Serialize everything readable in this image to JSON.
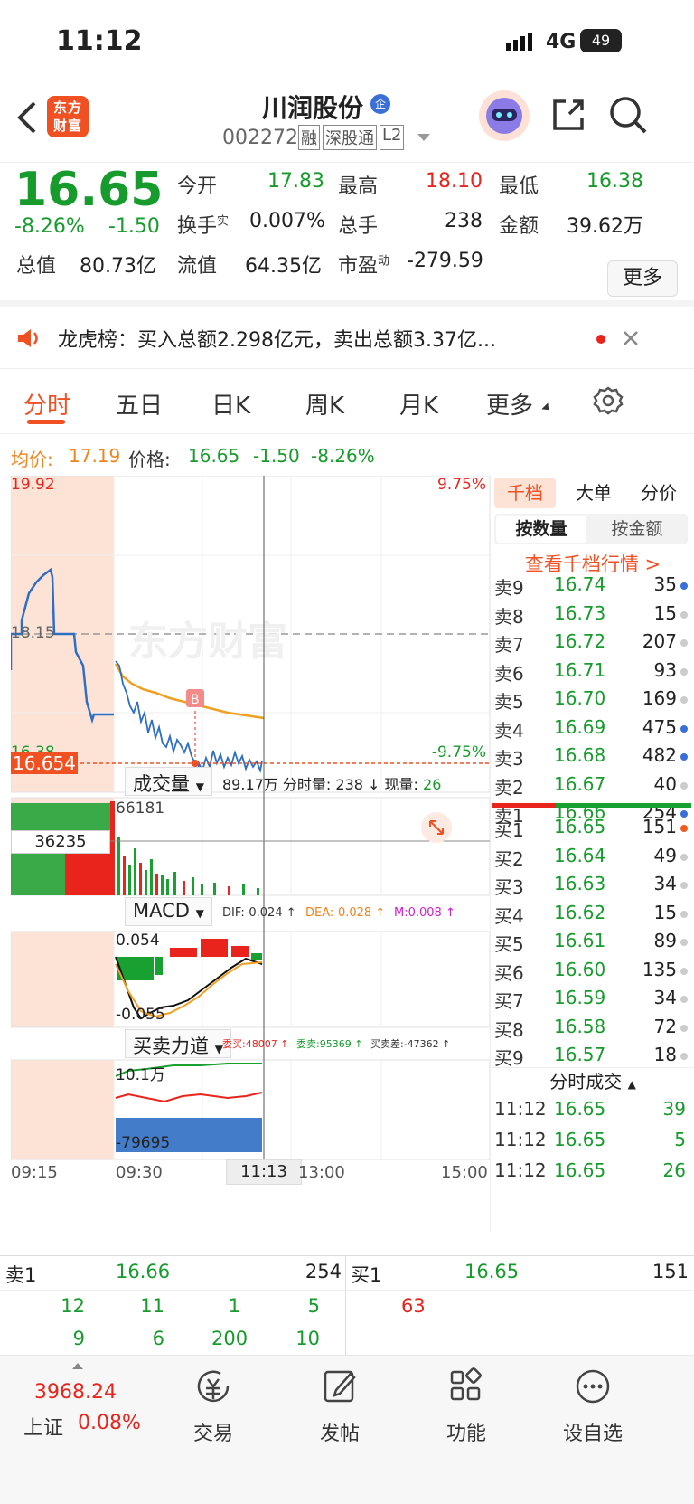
{
  "status_bar": {
    "time": "11:12",
    "network": "4G",
    "battery": "49"
  },
  "nav": {
    "app_logo": "东方财富",
    "stock_name": "川润股份",
    "name_badge": "企",
    "code": "002272",
    "tags": [
      "融",
      "深股通",
      "L2"
    ]
  },
  "quote": {
    "price": "16.65",
    "change_pct": "-8.26%",
    "change": "-1.50",
    "fields": [
      {
        "label": "今开",
        "value": "17.83"
      },
      {
        "label": "最高",
        "value": "18.10"
      },
      {
        "label": "最低",
        "value": "16.38"
      },
      {
        "label": "换手",
        "sup": "实",
        "value": "0.007%"
      },
      {
        "label": "总手",
        "value": "238"
      },
      {
        "label": "金额",
        "value": "39.62万"
      },
      {
        "label": "总值",
        "value": "80.73亿"
      },
      {
        "label": "流值",
        "value": "64.35亿"
      },
      {
        "label": "市盈",
        "sup": "动",
        "value": "-279.59"
      }
    ],
    "more_button": "更多"
  },
  "news": {
    "text": "龙虎榜：买入总额2.298亿元，卖出总额3.37亿..."
  },
  "tabs": [
    "分时",
    "五日",
    "日K",
    "周K",
    "月K",
    "更多"
  ],
  "legend": {
    "avg_label": "均价:",
    "avg_value": "17.19",
    "price_label": "价格:",
    "price_value": "16.65",
    "change": "-1.50",
    "change_pct": "-8.26%"
  },
  "chart": {
    "y_high": "19.92",
    "y_mid": "18.15",
    "y_low": "16.38",
    "pct_high": "9.75%",
    "pct_low": "-9.75%",
    "cursor_price": "16.654",
    "marker": "B",
    "watermark": "东方财富",
    "volume_header": {
      "selector": "成交量",
      "total": "89.17万",
      "minute_label": "分时量:",
      "minute_value": "238",
      "now_label": "现量:",
      "now_value": "26"
    },
    "volume_max": "66181",
    "volume_cursor": "36235",
    "macd_header": {
      "selector": "MACD",
      "dif": "DIF:-0.024 ↑",
      "dea": "DEA:-0.028 ↑",
      "m": "M:0.008 ↑"
    },
    "macd_top": "0.054",
    "macd_bottom": "-0.055",
    "power_header": {
      "selector": "买卖力道",
      "buy": "委买:48007 ↑",
      "sell": "委卖:95369 ↑",
      "diff": "买卖差:-47362 ↑"
    },
    "power_top": "10.1万",
    "power_bottom": "-79695",
    "time_labels": [
      "09:15",
      "09:30",
      "11:13",
      "13:00",
      "15:00"
    ]
  },
  "depth": {
    "tabs": [
      "千档",
      "大单",
      "分价"
    ],
    "subtabs": [
      "按数量",
      "按金额"
    ],
    "link": "查看千档行情 >",
    "asks": [
      {
        "label": "卖9",
        "price": "16.74",
        "vol": "35",
        "dot": "#3a6fd8"
      },
      {
        "label": "卖8",
        "price": "16.73",
        "vol": "15",
        "dot": "#cccccc"
      },
      {
        "label": "卖7",
        "price": "16.72",
        "vol": "207",
        "dot": "#cccccc"
      },
      {
        "label": "卖6",
        "price": "16.71",
        "vol": "93",
        "dot": "#cccccc"
      },
      {
        "label": "卖5",
        "price": "16.70",
        "vol": "169",
        "dot": "#cccccc"
      },
      {
        "label": "卖4",
        "price": "16.69",
        "vol": "475",
        "dot": "#3a6fd8"
      },
      {
        "label": "卖3",
        "price": "16.68",
        "vol": "482",
        "dot": "#3a6fd8"
      },
      {
        "label": "卖2",
        "price": "16.67",
        "vol": "40",
        "dot": "#cccccc"
      },
      {
        "label": "卖1",
        "price": "16.66",
        "vol": "254",
        "dot": "#3a6fd8"
      }
    ],
    "bids": [
      {
        "label": "买1",
        "price": "16.65",
        "vol": "151",
        "dot": "#f05a1e"
      },
      {
        "label": "买2",
        "price": "16.64",
        "vol": "49",
        "dot": "#cccccc"
      },
      {
        "label": "买3",
        "price": "16.63",
        "vol": "34",
        "dot": "#cccccc"
      },
      {
        "label": "买4",
        "price": "16.62",
        "vol": "15",
        "dot": "#cccccc"
      },
      {
        "label": "买5",
        "price": "16.61",
        "vol": "89",
        "dot": "#cccccc"
      },
      {
        "label": "买6",
        "price": "16.60",
        "vol": "135",
        "dot": "#cccccc"
      },
      {
        "label": "买7",
        "price": "16.59",
        "vol": "34",
        "dot": "#cccccc"
      },
      {
        "label": "买8",
        "price": "16.58",
        "vol": "72",
        "dot": "#cccccc"
      },
      {
        "label": "买9",
        "price": "16.57",
        "vol": "18",
        "dot": "#cccccc"
      }
    ],
    "trades_title": "分时成交",
    "trades": [
      {
        "time": "11:12",
        "price": "16.65",
        "vol": "39"
      },
      {
        "time": "11:12",
        "price": "16.65",
        "vol": "5"
      },
      {
        "time": "11:12",
        "price": "16.65",
        "vol": "26"
      }
    ]
  },
  "orders": {
    "sell_label": "卖1",
    "sell_price": "16.66",
    "sell_vol": "254",
    "buy_label": "买1",
    "buy_price": "16.65",
    "buy_vol": "151",
    "sell_queue": [
      [
        "12",
        "11",
        "1",
        "5"
      ],
      [
        "9",
        "6",
        "200",
        "10"
      ]
    ],
    "buy_queue": [
      "63"
    ]
  },
  "bottom": {
    "index_value": "3968.24",
    "index_name": "上证",
    "index_change": "0.08%",
    "items": [
      "交易",
      "发帖",
      "功能",
      "设自选"
    ]
  }
}
